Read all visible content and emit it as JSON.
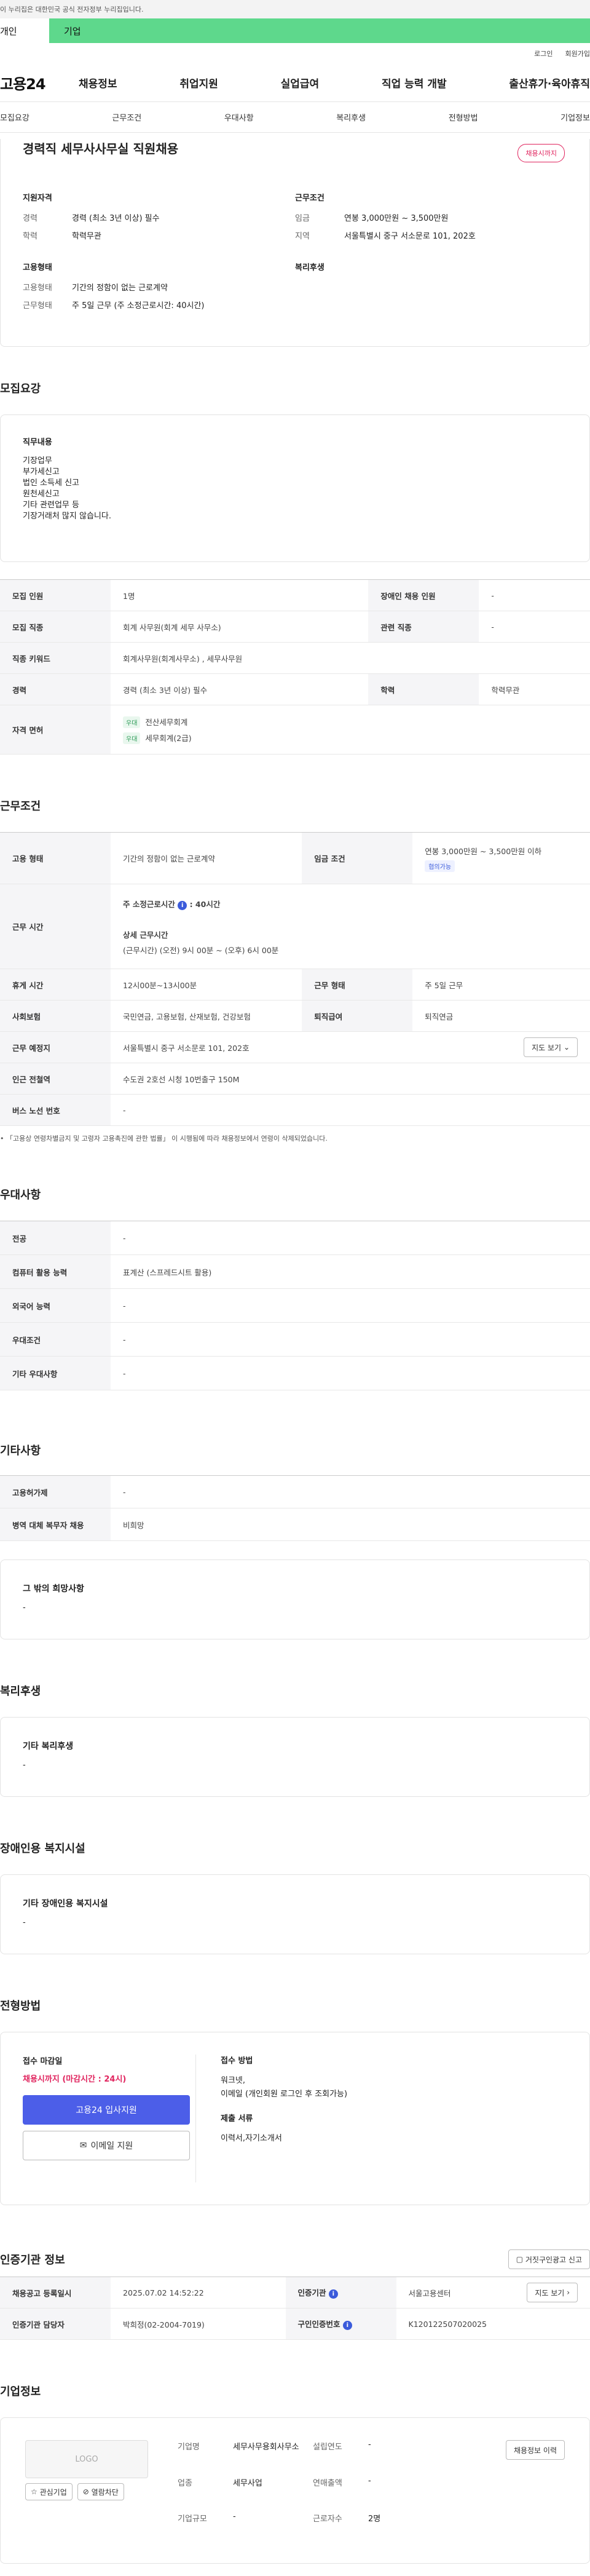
{
  "gov_banner": "이 누리집은 대한민국 공식 전자정부 누리집입니다.",
  "topbar": {
    "tab_personal": "개인",
    "tab_company": "기업"
  },
  "util": {
    "login": "로그인",
    "signup": "회원가입"
  },
  "logo": "고용24",
  "gnb": [
    "채용정보",
    "취업지원",
    "실업급여",
    "직업 능력 개발",
    "출산휴가·육아휴직"
  ],
  "subnav": [
    "모집요강",
    "근무조건",
    "우대사항",
    "복리후생",
    "전형방법",
    "기업정보"
  ],
  "summary": {
    "title": "경력직 세무사사무실 직원채용",
    "badge": "채용시까지",
    "qual_title": "지원자격",
    "qual": [
      {
        "k": "경력",
        "v": "경력 (최소 3년 이상) 필수"
      },
      {
        "k": "학력",
        "v": "학력무관"
      }
    ],
    "cond_title": "근무조건",
    "cond": [
      {
        "k": "임금",
        "v": "연봉 3,000만원 ~ 3,500만원"
      },
      {
        "k": "지역",
        "v": "서울특별시 중구 서소문로 101, 202호"
      }
    ],
    "emp_title": "고용형태",
    "emp": [
      {
        "k": "고용형태",
        "v": "기간의 정함이 없는 근로계약"
      },
      {
        "k": "근무형태",
        "v": "주 5일 근무 (주 소정근로시간: 40시간)"
      }
    ],
    "welfare_title": "복리후생"
  },
  "recruit": {
    "title": "모집요강",
    "duty_title": "직무내용",
    "duties": [
      "기장업무",
      "부가세신고",
      "법인 소득세 신고",
      "원천세신고",
      "기타 관련업무 등",
      "기장거래처 많지 않습니다."
    ],
    "rows": {
      "headcount_k": "모집 인원",
      "headcount_v": "1명",
      "disabled_k": "장애인 채용 인원",
      "disabled_v": "-",
      "job_k": "모집 직종",
      "job_v": "회계 사무원(회계 세무 사무소)",
      "related_k": "관련 직종",
      "related_v": "-",
      "keyword_k": "직종 키워드",
      "keyword_v": "회계사무원(회계사무소) , 세무사무원",
      "career_k": "경력",
      "career_v": "경력 (최소 3년 이상) 필수",
      "edu_k": "학력",
      "edu_v": "학력무관",
      "license_k": "자격 면허",
      "license_chip": "우대",
      "licenses": [
        "전산세무회계",
        "세무회계(2급)"
      ]
    }
  },
  "work": {
    "title": "근무조건",
    "emp_k": "고용 형태",
    "emp_v": "기간의 정함이 없는 근로계약",
    "wage_k": "임금 조건",
    "wage_v": "연봉 3,000만원 ~ 3,500만원 이하",
    "wage_chip": "협의가능",
    "hours_k": "근무 시간",
    "hours_main": "주 소정근로시간",
    "hours_main_v": ": 40시간",
    "hours_detail_title": "상세 근무시간",
    "hours_detail": "(근무시간) (오전) 9시 00분 ~ (오후) 6시 00분",
    "break_k": "휴게 시간",
    "break_v": "12시00분~13시00분",
    "type_k": "근무 형태",
    "type_v": "주 5일 근무",
    "ins_k": "사회보험",
    "ins_v": "국민연금, 고용보험, 산재보험, 건강보험",
    "retire_k": "퇴직급여",
    "retire_v": "퇴직연금",
    "place_k": "근무 예정지",
    "place_v": "서울특별시 중구 서소문로 101, 202호",
    "map_btn": "지도 보기",
    "station_k": "인근 전철역",
    "station_v": "수도권 2호선 시청 10번출구 150M",
    "bus_k": "버스 노선 번호",
    "bus_v": "-",
    "notice": "「고용상 연령차별금지 및 고령자 고용촉진에 관한 법률」 이 시행됨에 따라 채용정보에서 연령이 삭제되었습니다."
  },
  "pref": {
    "title": "우대사항",
    "major_k": "전공",
    "major_v": "-",
    "pc_k": "컴퓨터 활용 능력",
    "pc_v": "표계산 (스프레드시트 활용)",
    "lang_k": "외국어 능력",
    "lang_v": "-",
    "cond_k": "우대조건",
    "cond_v": "-",
    "etc_k": "기타 우대사항",
    "etc_v": "-"
  },
  "others": {
    "title": "기타사항",
    "lang_k": "고용허가제",
    "lang_v": "-",
    "mil_k": "병역 대체 복무자 채용",
    "mil_v": "비희망",
    "hope_title": "그 밖의 희망사항",
    "hope_v": "-"
  },
  "welfare": {
    "title": "복리후생",
    "sub": "기타 복리후생",
    "v": "-"
  },
  "disabled_fac": {
    "title": "장애인용 복지시설",
    "sub": "기타 장애인용 복지시설",
    "v": "-"
  },
  "process": {
    "title": "전형방법",
    "deadline_title": "접수 마감일",
    "deadline_v": "채용시까지 (마감시간 : 24시)",
    "apply_btn": "고용24 입사지원",
    "email_btn": "이메일 지원",
    "method_title": "접수 방법",
    "method_v": [
      "워크넷,",
      "이메일 (개인회원 로그인 후 조회가능)"
    ],
    "docs_title": "제출 서류",
    "docs_v": "이력서,자기소개서"
  },
  "agency": {
    "title": "인증기관 정보",
    "report_btn": "거짓구인광고 신고",
    "date_k": "채용공고 등록일시",
    "date_v": "2025.07.02 14:52:22",
    "org_k": "인증기관",
    "org_v": "서울고용센터",
    "map_btn": "지도 보기",
    "mgr_k": "인증기관 담당자",
    "mgr_v": "박희정(02-2004-7019)",
    "no_k": "구인인증번호",
    "no_v": "K120122507020025"
  },
  "company": {
    "title": "기업정보",
    "logo_placeholder": "LOGO",
    "fav_btn": "관심기업",
    "block_btn": "열람차단",
    "name_k": "기업명",
    "name_v": "세무사무용회사무소",
    "biz_k": "업종",
    "biz_v": "세무사업",
    "size_k": "기업규모",
    "size_v": "-",
    "founded_k": "설립연도",
    "founded_v": "-",
    "sales_k": "연매출액",
    "sales_v": "-",
    "emp_k": "근로자수",
    "emp_v": "2명",
    "history_btn": "채용정보 이력"
  }
}
